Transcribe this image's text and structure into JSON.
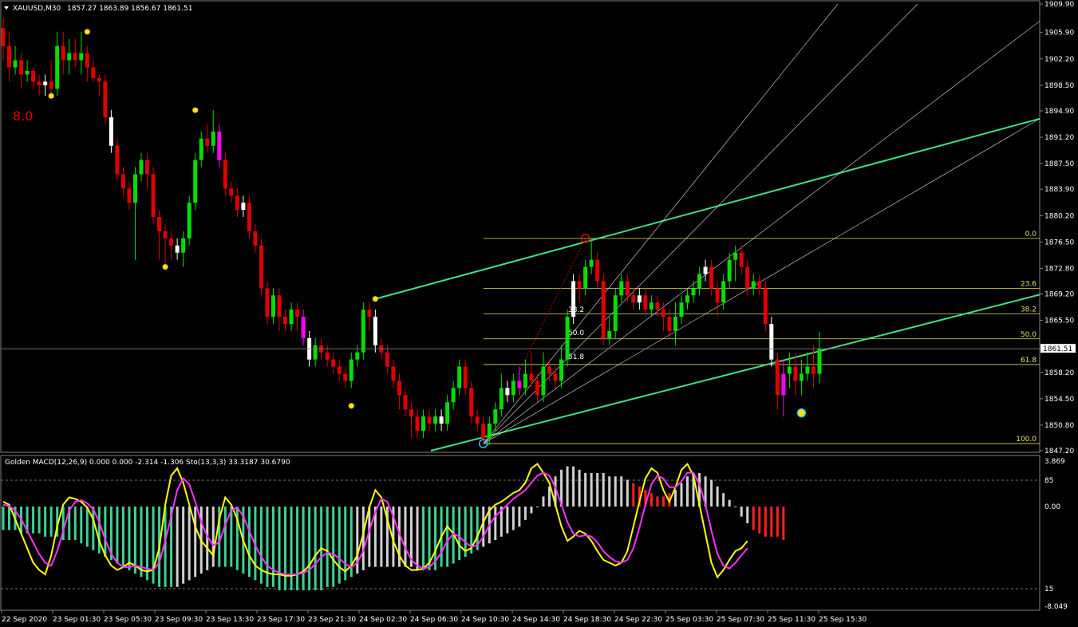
{
  "chart_header": {
    "symbol": "XAUUSD,M30",
    "ohlc": "1857.27 1863.89 1856.67 1861.51"
  },
  "overlay_label": "8.0",
  "indicator_header": "Golden MACD(12,26,9) 0.000 0.000 -2.314 -1.306  Sto(13,3,3) 33.3187 30.6790",
  "colors": {
    "background": "#000000",
    "bull": "#00e000",
    "bear": "#e00000",
    "neutral": "#ffffff",
    "magenta": "#ff00ff",
    "trendline": "#40e080",
    "fib": "#e0e060",
    "stoch_main": "#ffff00",
    "stoch_signal": "#ff30ff",
    "hist_neg": "#40d090",
    "hist_pos": "#ff2020",
    "hist_neutral": "#d0d0d0"
  },
  "chart_data": [
    {
      "type": "candlestick",
      "title": "XAUUSD,M30",
      "ylim": [
        1847.2,
        1909.9
      ],
      "y_ticks": [
        "1909.90",
        "1905.90",
        "1902.20",
        "1898.50",
        "1894.90",
        "1891.20",
        "1887.50",
        "1883.90",
        "1880.20",
        "1876.50",
        "1872.80",
        "1869.20",
        "1865.50",
        "1861.51",
        "1858.20",
        "1854.50",
        "1850.80",
        "1847.20"
      ],
      "current_price": "1861.51",
      "fib_levels": [
        {
          "label": "0.0",
          "price": 1877.0
        },
        {
          "label": "23.6",
          "price": 1870.0
        },
        {
          "label": "38.2",
          "price": 1866.4
        },
        {
          "label": "50.0",
          "price": 1862.9
        },
        {
          "label": "61.8",
          "price": 1859.3
        },
        {
          "label": "100.0",
          "price": 1848.2
        }
      ],
      "fan_labels": [
        "38.2",
        "50.0",
        "61.8"
      ],
      "x_labels": [
        "22 Sep 2020",
        "23 Sep 01:30",
        "23 Sep 05:30",
        "23 Sep 09:30",
        "23 Sep 13:30",
        "23 Sep 17:30",
        "23 Sep 21:30",
        "24 Sep 02:30",
        "24 Sep 06:30",
        "24 Sep 10:30",
        "24 Sep 14:30",
        "24 Sep 18:30",
        "24 Sep 22:30",
        "25 Sep 03:30",
        "25 Sep 07:30",
        "25 Sep 11:30",
        "25 Sep 15:30"
      ],
      "candles": [
        [
          1906.5,
          1904,
          1908,
          1902
        ],
        [
          1904,
          1901,
          1906,
          1899
        ],
        [
          1901,
          1902,
          1904,
          1900
        ],
        [
          1902,
          1900,
          1903,
          1898
        ],
        [
          1900,
          1900.5,
          1902,
          1899
        ],
        [
          1900.5,
          1899,
          1901,
          1898
        ],
        [
          1899,
          1898.5,
          1900,
          1897
        ],
        [
          1898.5,
          1899,
          1900,
          1897
        ],
        [
          1899,
          1898,
          1902,
          1897
        ],
        [
          1898,
          1904,
          1906,
          1897
        ],
        [
          1904,
          1902,
          1906,
          1900
        ],
        [
          1902,
          1903,
          1905,
          1900
        ],
        [
          1903,
          1902,
          1905,
          1901
        ],
        [
          1902,
          1903,
          1906,
          1900
        ],
        [
          1903,
          1901,
          1904,
          1899
        ],
        [
          1901,
          1899.5,
          1902,
          1899
        ],
        [
          1899.5,
          1899,
          1900,
          1897
        ],
        [
          1899,
          1894,
          1900,
          1893
        ],
        [
          1894,
          1890,
          1895,
          1889
        ],
        [
          1890,
          1886,
          1891,
          1885
        ],
        [
          1886,
          1884,
          1887,
          1883
        ],
        [
          1884,
          1882,
          1885,
          1881
        ],
        [
          1882,
          1886,
          1887,
          1874
        ],
        [
          1886,
          1888,
          1889,
          1885
        ],
        [
          1888,
          1886,
          1889,
          1884
        ],
        [
          1886,
          1880,
          1887,
          1879
        ],
        [
          1880,
          1878,
          1881,
          1874
        ],
        [
          1878,
          1877,
          1879,
          1873
        ],
        [
          1877,
          1876,
          1878,
          1874
        ],
        [
          1876,
          1875,
          1877,
          1874
        ],
        [
          1875,
          1877,
          1878,
          1873
        ],
        [
          1877,
          1882,
          1883,
          1876
        ],
        [
          1882,
          1888,
          1889,
          1881
        ],
        [
          1888,
          1891,
          1892,
          1887
        ],
        [
          1891,
          1890,
          1893,
          1889
        ],
        [
          1890,
          1892,
          1895,
          1889
        ],
        [
          1892,
          1888,
          1893,
          1887
        ],
        [
          1888,
          1884,
          1889,
          1883
        ],
        [
          1884,
          1883,
          1885,
          1882
        ],
        [
          1883,
          1881,
          1884,
          1880
        ],
        [
          1881,
          1882,
          1883,
          1880
        ],
        [
          1882,
          1878,
          1883,
          1877
        ],
        [
          1878,
          1876,
          1879,
          1875
        ],
        [
          1876,
          1870,
          1877,
          1869
        ],
        [
          1870,
          1866,
          1871,
          1865
        ],
        [
          1866,
          1869,
          1870,
          1865
        ],
        [
          1869,
          1866,
          1870,
          1864
        ],
        [
          1866,
          1865,
          1867,
          1864
        ],
        [
          1865,
          1867,
          1868,
          1864
        ],
        [
          1867,
          1866,
          1868,
          1864
        ],
        [
          1866,
          1863,
          1867,
          1862
        ],
        [
          1863,
          1860,
          1864,
          1859
        ],
        [
          1860,
          1862,
          1863,
          1859
        ],
        [
          1862,
          1861,
          1863,
          1860
        ],
        [
          1861,
          1860,
          1862,
          1859
        ],
        [
          1860,
          1859,
          1861,
          1858
        ],
        [
          1859,
          1858,
          1860,
          1857
        ],
        [
          1858,
          1857,
          1859,
          1856
        ],
        [
          1857,
          1860,
          1861,
          1856
        ],
        [
          1860,
          1861,
          1862,
          1859
        ],
        [
          1861,
          1867,
          1868,
          1860
        ],
        [
          1867,
          1866,
          1868,
          1864
        ],
        [
          1866,
          1862,
          1867,
          1861
        ],
        [
          1862,
          1861,
          1863,
          1860
        ],
        [
          1861,
          1859,
          1862,
          1858
        ],
        [
          1859,
          1857,
          1860,
          1856
        ],
        [
          1857,
          1855,
          1858,
          1853
        ],
        [
          1855,
          1853,
          1856,
          1852
        ],
        [
          1853,
          1852,
          1854,
          1849
        ],
        [
          1852,
          1850,
          1853,
          1849
        ],
        [
          1850,
          1852,
          1853,
          1849
        ],
        [
          1852,
          1851,
          1853,
          1850
        ],
        [
          1851,
          1852,
          1853,
          1850
        ],
        [
          1852,
          1851,
          1853,
          1850
        ],
        [
          1851,
          1854,
          1855,
          1850
        ],
        [
          1854,
          1856,
          1857,
          1853
        ],
        [
          1856,
          1859,
          1860,
          1855
        ],
        [
          1859,
          1856,
          1860,
          1855
        ],
        [
          1856,
          1852,
          1857,
          1851
        ],
        [
          1852,
          1851,
          1853,
          1850
        ],
        [
          1851,
          1849,
          1852,
          1848
        ],
        [
          1849,
          1851,
          1852,
          1848
        ],
        [
          1851,
          1853,
          1854,
          1850
        ],
        [
          1853,
          1856,
          1858,
          1852
        ],
        [
          1856,
          1855,
          1857,
          1854
        ],
        [
          1855,
          1857,
          1858,
          1854
        ],
        [
          1857,
          1856,
          1859,
          1855
        ],
        [
          1856,
          1858,
          1860,
          1855
        ],
        [
          1858,
          1857,
          1861,
          1856
        ],
        [
          1857,
          1855,
          1858,
          1854
        ],
        [
          1855,
          1859,
          1861,
          1854
        ],
        [
          1859,
          1858,
          1860,
          1857
        ],
        [
          1858,
          1857,
          1859,
          1856
        ],
        [
          1857,
          1860,
          1862,
          1856
        ],
        [
          1860,
          1866,
          1867,
          1859
        ],
        [
          1866,
          1871,
          1872,
          1865
        ],
        [
          1871,
          1870,
          1872,
          1868
        ],
        [
          1870,
          1873,
          1874,
          1869
        ],
        [
          1873,
          1874,
          1877,
          1872
        ],
        [
          1874,
          1871,
          1875,
          1870
        ],
        [
          1871,
          1863,
          1872,
          1862
        ],
        [
          1863,
          1864,
          1866,
          1862
        ],
        [
          1864,
          1869,
          1870,
          1863
        ],
        [
          1869,
          1871,
          1872,
          1868
        ],
        [
          1871,
          1869,
          1872,
          1868
        ],
        [
          1869,
          1868,
          1870,
          1867
        ],
        [
          1868,
          1869,
          1870,
          1867
        ],
        [
          1869,
          1867,
          1870,
          1866
        ],
        [
          1867,
          1868,
          1869,
          1866
        ],
        [
          1868,
          1867,
          1869,
          1866
        ],
        [
          1867,
          1866,
          1868,
          1864
        ],
        [
          1866,
          1864,
          1867,
          1863
        ],
        [
          1864,
          1866,
          1868,
          1862
        ],
        [
          1866,
          1868,
          1869,
          1865
        ],
        [
          1868,
          1869,
          1870,
          1867
        ],
        [
          1869,
          1870,
          1871,
          1868
        ],
        [
          1870,
          1872,
          1873,
          1869
        ],
        [
          1872,
          1873,
          1874,
          1871
        ],
        [
          1873,
          1870,
          1874,
          1869
        ],
        [
          1870,
          1868,
          1871,
          1866
        ],
        [
          1868,
          1871,
          1872,
          1867
        ],
        [
          1871,
          1874,
          1875,
          1870
        ],
        [
          1874,
          1875,
          1876,
          1871
        ],
        [
          1875,
          1873,
          1876,
          1872
        ],
        [
          1873,
          1870,
          1874,
          1869
        ],
        [
          1870,
          1871,
          1872,
          1869
        ],
        [
          1871,
          1870,
          1872,
          1869
        ],
        [
          1870,
          1865,
          1871,
          1864
        ],
        [
          1865,
          1860,
          1866,
          1859
        ],
        [
          1860,
          1855,
          1861,
          1853
        ],
        [
          1855,
          1858,
          1860,
          1852
        ],
        [
          1858,
          1859,
          1861,
          1856
        ],
        [
          1859,
          1857,
          1861,
          1855
        ],
        [
          1857,
          1858,
          1860,
          1855
        ],
        [
          1858,
          1859,
          1861,
          1857
        ],
        [
          1859,
          1858,
          1862,
          1856
        ],
        [
          1858,
          1861.51,
          1863.89,
          1856.67
        ]
      ],
      "histogram": [
        -7,
        -7,
        -7,
        -8,
        -8,
        -8,
        -8,
        -9,
        -9,
        -9,
        -10,
        -10,
        -10,
        -11,
        -12,
        -13,
        -14,
        -15,
        -16,
        -17,
        -18,
        -19,
        -20,
        -21,
        -22,
        -23,
        -24,
        -24,
        -24,
        -24,
        -23,
        -22,
        -21,
        -20,
        -19,
        -18,
        -18,
        -18,
        -18,
        -19,
        -20,
        -21,
        -22,
        -23,
        -24,
        -24,
        -25,
        -25,
        -25,
        -25,
        -25,
        -25,
        -25,
        -25,
        -24,
        -24,
        -23,
        -22,
        -21,
        -20,
        -19,
        -18,
        -18,
        -18,
        -18,
        -18,
        -18,
        -18,
        -18,
        -19,
        -19,
        -19,
        -19,
        -18,
        -18,
        -17,
        -16,
        -15,
        -14,
        -13,
        -12,
        -11,
        -10,
        -9,
        -8,
        -7,
        -6,
        -4,
        -2,
        0,
        3,
        6,
        9,
        11,
        12,
        12,
        11,
        10,
        10,
        10,
        10,
        9,
        9,
        9,
        8,
        7,
        6,
        5,
        4,
        3,
        3,
        4,
        5,
        7,
        9,
        10,
        10,
        9,
        8,
        6,
        4,
        2,
        0,
        -3,
        -5,
        -7,
        -8,
        -9,
        -9,
        -9,
        -10
      ],
      "hist_colors": "gggggggggggggggggggggggggggggwwwwwwwgggggggggggggggggggggggwwwwwwwwwwwggggggggggwwwwwwwwwwwwwwwwwwwwwwwwwrrrrrrrwwwwwwwwwwwwwrrrrrrrrrrwwwggggggg",
      "stoch_main": [
        72,
        70,
        60,
        50,
        40,
        30,
        25,
        22,
        35,
        55,
        70,
        75,
        74,
        72,
        68,
        60,
        45,
        35,
        28,
        25,
        27,
        30,
        28,
        25,
        24,
        25,
        40,
        70,
        90,
        95,
        85,
        70,
        55,
        45,
        40,
        35,
        60,
        75,
        70,
        60,
        45,
        35,
        28,
        25,
        23,
        22,
        22,
        21,
        21,
        22,
        24,
        28,
        35,
        40,
        38,
        32,
        27,
        24,
        28,
        35,
        50,
        68,
        80,
        75,
        60,
        45,
        35,
        28,
        25,
        25,
        26,
        30,
        38,
        48,
        55,
        50,
        42,
        38,
        40,
        48,
        58,
        66,
        70,
        72,
        75,
        78,
        80,
        85,
        95,
        98,
        92,
        85,
        70,
        55,
        45,
        48,
        52,
        50,
        45,
        38,
        32,
        30,
        28,
        30,
        38,
        55,
        72,
        88,
        95,
        92,
        80,
        72,
        82,
        94,
        98,
        90,
        70,
        50,
        30,
        20,
        25,
        32,
        38,
        40,
        45
      ],
      "stoch_signal": [
        70,
        69,
        66,
        60,
        52,
        44,
        36,
        30,
        28,
        38,
        52,
        66,
        72,
        73,
        71,
        67,
        58,
        46,
        36,
        30,
        27,
        27,
        28,
        27,
        26,
        25,
        30,
        45,
        62,
        80,
        88,
        84,
        72,
        58,
        48,
        42,
        44,
        56,
        66,
        68,
        62,
        52,
        42,
        34,
        28,
        25,
        23,
        22,
        22,
        22,
        23,
        25,
        29,
        34,
        37,
        36,
        33,
        29,
        27,
        30,
        38,
        52,
        65,
        74,
        72,
        62,
        50,
        40,
        32,
        28,
        26,
        27,
        31,
        37,
        45,
        50,
        48,
        44,
        41,
        42,
        48,
        56,
        62,
        66,
        70,
        74,
        77,
        80,
        85,
        90,
        92,
        90,
        82,
        70,
        58,
        50,
        48,
        49,
        48,
        44,
        38,
        34,
        31,
        30,
        32,
        40,
        54,
        70,
        84,
        90,
        88,
        82,
        82,
        86,
        92,
        92,
        84,
        70,
        52,
        36,
        28,
        26,
        30,
        35,
        40
      ]
    }
  ]
}
